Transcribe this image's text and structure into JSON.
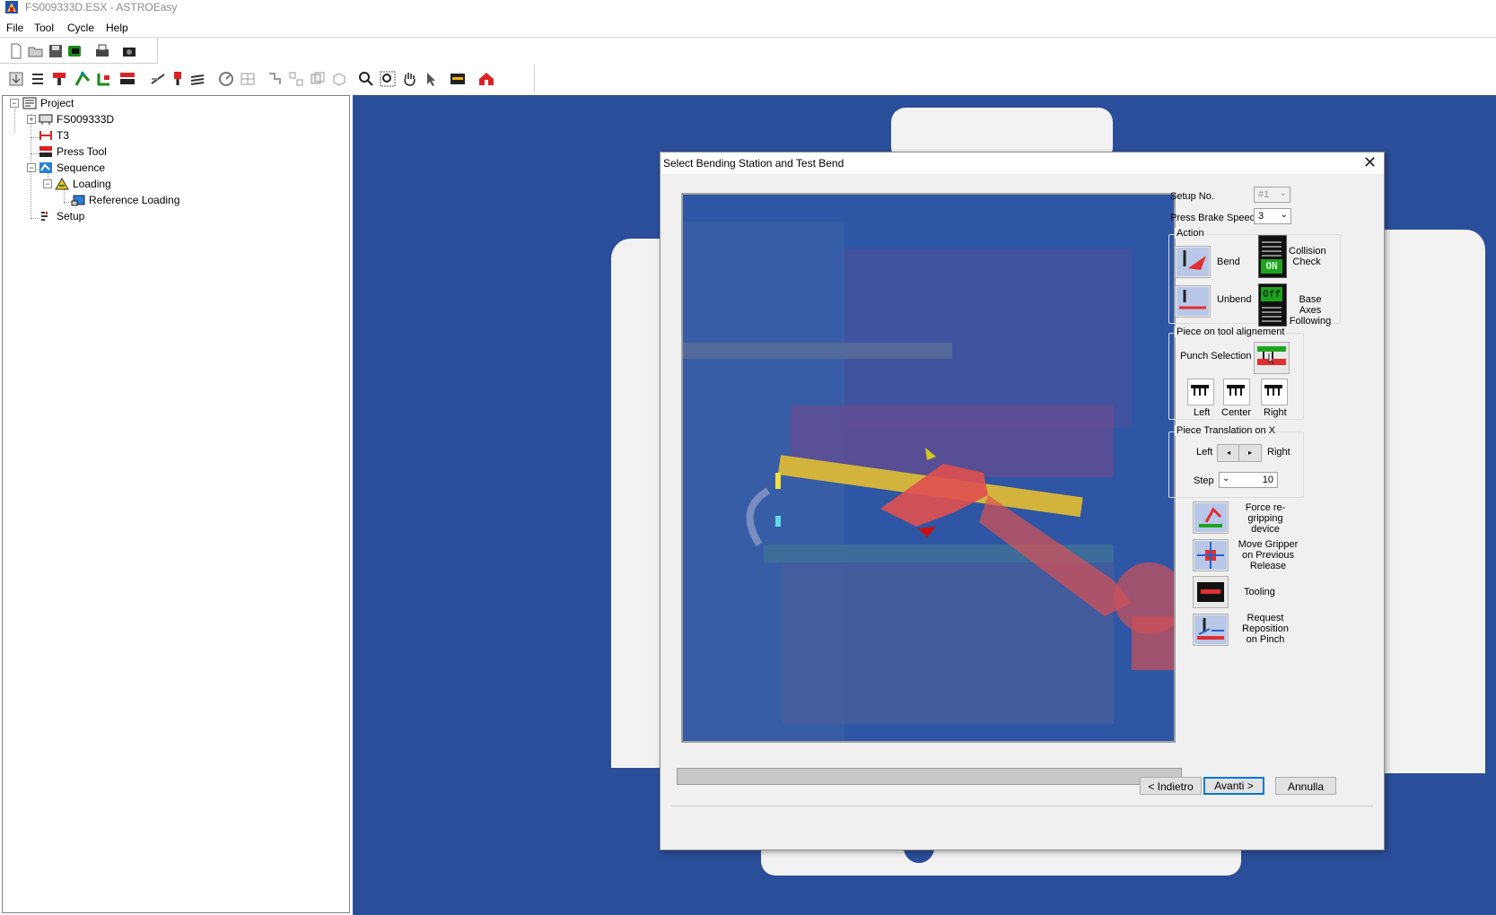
{
  "window": {
    "title": "FS009333D.ESX - ASTROEasy"
  },
  "menu": [
    "File",
    "Tool",
    "Cycle",
    "Help"
  ],
  "tree": {
    "project": "Project",
    "part": "FS009333D",
    "t3": "T3",
    "press_tool": "Press Tool",
    "sequence": "Sequence",
    "loading": "Loading",
    "reference_loading": "Reference Loading",
    "setup": "Setup"
  },
  "dialog": {
    "title": "Select Bending Station and Test Bend",
    "setup_no_label": "Setup No.",
    "setup_no_value": "#1",
    "speed_label": "Press Brake Speed:",
    "speed_value": "3",
    "action_group": "Action",
    "bend": "Bend",
    "unbend": "Unbend",
    "collision_check": "Collision Check",
    "collision_state": "ON",
    "base_axes": "Base Axes Following",
    "base_axes_state": "Off",
    "alignment_group": "Piece on tool alignement",
    "punch_selection": "Punch Selection",
    "left": "Left",
    "center": "Center",
    "right": "Right",
    "translation_group": "Piece Translation on X",
    "trans_left": "Left",
    "trans_right": "Right",
    "step_label": "Step",
    "step_value": "10",
    "force_regripping": "Force re-gripping device",
    "move_gripper": "Move Gripper on Previous Release",
    "tooling": "Tooling",
    "request_reposition": "Request Reposition on Pinch",
    "back_button": "< Indietro",
    "next_button": "Avanti >",
    "cancel_button": "Annulla"
  },
  "colors": {
    "viewport_bg": "#2b4e9a",
    "scene_bg": "#2e56a4",
    "robot": "#e05050",
    "tool_gold": "#d2b43c",
    "on_green": "#1fa31f"
  }
}
